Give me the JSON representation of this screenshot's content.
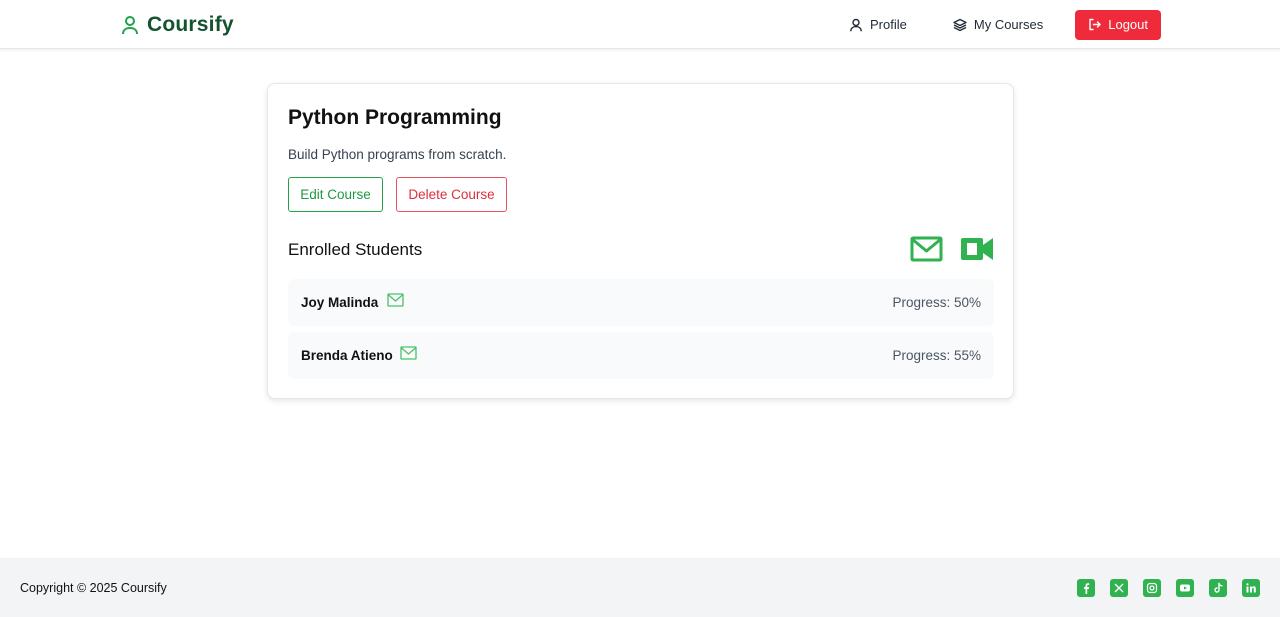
{
  "colors": {
    "brand": "#14532d",
    "accent_green": "#2fb24f",
    "danger": "#ef2b3b"
  },
  "header": {
    "brand_icon": "user-icon",
    "brand_name": "Coursify",
    "nav": {
      "profile": {
        "label": "Profile",
        "icon": "user-icon"
      },
      "my_courses": {
        "label": "My Courses",
        "icon": "layers-icon"
      },
      "logout": {
        "label": "Logout",
        "icon": "logout-icon"
      }
    }
  },
  "course": {
    "title": "Python Programming",
    "description": "Build Python programs from scratch.",
    "edit_label": "Edit Course",
    "delete_label": "Delete Course"
  },
  "students": {
    "heading": "Enrolled Students",
    "actions": [
      "mail-icon",
      "video-icon"
    ],
    "items": [
      {
        "name": "Joy Malinda",
        "progress": "Progress: 50%",
        "icon": "mail-icon"
      },
      {
        "name": "Brenda Atieno",
        "progress": "Progress: 55%",
        "icon": "mail-icon"
      }
    ]
  },
  "footer": {
    "copyright": "Copyright © 2025 Coursify",
    "socials": [
      "facebook-icon",
      "x-icon",
      "instagram-icon",
      "youtube-icon",
      "tiktok-icon",
      "linkedin-icon"
    ]
  }
}
